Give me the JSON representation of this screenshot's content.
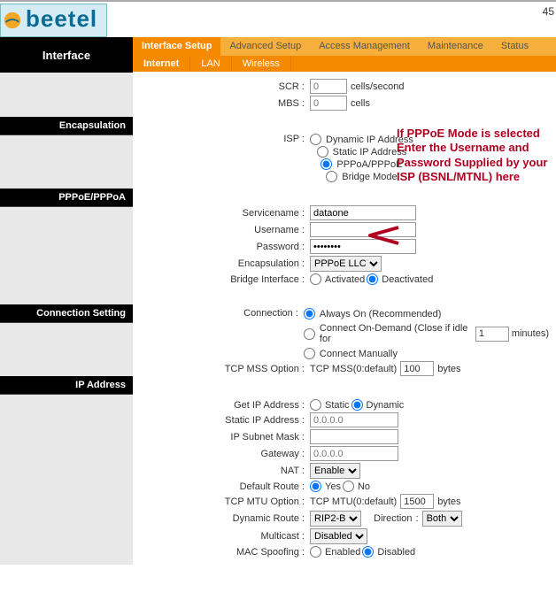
{
  "brand": "beetel",
  "corner": "45",
  "sidebar": {
    "title": "Interface",
    "sections": [
      "Encapsulation",
      "PPPoE/PPPoA",
      "Connection Setting",
      "IP Address"
    ]
  },
  "nav": {
    "tabs": [
      "Interface Setup",
      "Advanced Setup",
      "Access Management",
      "Maintenance",
      "Status"
    ],
    "subtabs": [
      "Internet",
      "LAN",
      "Wireless"
    ]
  },
  "scr": {
    "label": "SCR",
    "value": "0",
    "unit": "cells/second"
  },
  "mbs": {
    "label": "MBS",
    "value": "0",
    "unit": "cells"
  },
  "isp": {
    "label": "ISP",
    "options": [
      "Dynamic IP Address",
      "Static IP Address",
      "PPPoA/PPPoE",
      "Bridge Mode"
    ]
  },
  "ppp": {
    "servicename_label": "Servicename",
    "servicename": "dataone",
    "username_label": "Username",
    "username": "",
    "password_label": "Password",
    "password": "••••••••",
    "encap_label": "Encapsulation",
    "encap_value": "PPPoE LLC",
    "bridge_label": "Bridge Interface",
    "bridge_activated": "Activated",
    "bridge_deactivated": "Deactivated"
  },
  "conn": {
    "label": "Connection",
    "always": "Always On (Recommended)",
    "ondemand": "Connect On-Demand (Close if idle for",
    "ondemand_unit": "minutes)",
    "ondemand_value": "1",
    "manual": "Connect Manually",
    "mss_label": "TCP MSS Option",
    "mss_prefix": "TCP MSS(0:default)",
    "mss_value": "100",
    "mss_unit": "bytes"
  },
  "ip": {
    "get_label": "Get IP Address",
    "static": "Static",
    "dynamic": "Dynamic",
    "static_ip_label": "Static IP Address",
    "static_ip": "0.0.0.0",
    "mask_label": "IP Subnet Mask",
    "gw_label": "Gateway",
    "gw": "0.0.0.0",
    "nat_label": "NAT",
    "nat_value": "Enable",
    "defroute_label": "Default Route",
    "yes": "Yes",
    "no": "No",
    "mtu_label": "TCP MTU Option",
    "mtu_prefix": "TCP MTU(0:default)",
    "mtu_value": "1500",
    "mtu_unit": "bytes",
    "dynroute_label": "Dynamic Route",
    "dynroute_value": "RIP2-B",
    "direction_label": "Direction",
    "direction_value": "Both",
    "multicast_label": "Multicast",
    "multicast_value": "Disabled",
    "macspoof_label": "MAC Spoofing",
    "enabled": "Enabled",
    "disabled": "Disabled"
  },
  "annotation": "If PPPoE Mode is selected Enter the Username and Password Supplied by your ISP (BSNL/MTNL) here"
}
